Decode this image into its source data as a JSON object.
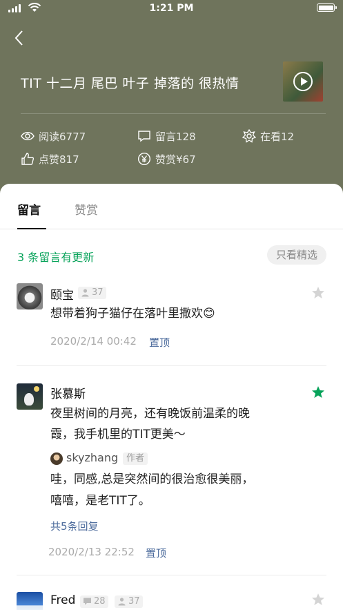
{
  "status_bar": {
    "time": "1:21 PM"
  },
  "article": {
    "title": "TIT 十二月 尾巴 叶子 掉落的 很热情",
    "stats": {
      "reads": "阅读6777",
      "comments": "留言128",
      "watching": "在看12",
      "likes": "点赞817",
      "tips": "赞赏¥67"
    }
  },
  "tabs": {
    "comments": "留言",
    "tips": "赞赏"
  },
  "updates_text": "3 条留言有更新",
  "filter_label": "只看精选",
  "comments": [
    {
      "name": "颐宝",
      "badge_count": "37",
      "text": "想带着狗子猫仔在落叶里撒欢",
      "emoji": "😊",
      "date": "2020/2/14  00:42",
      "pin": "置顶",
      "starred": false
    },
    {
      "name": "张慕斯",
      "text_line1": "夜里树间的月亮，还有晚饭前温柔的晚",
      "text_line2": "霞，我手机里的TIT更美～",
      "reply": {
        "name": "skyzhang",
        "tag": "作者",
        "line1": "哇，同感,总是突然间的很治愈很美丽，",
        "line2": "嘻嘻，是老TIT了。"
      },
      "replies_link": "共5条回复",
      "date": "2020/2/13  22:52",
      "pin": "置顶",
      "starred": true
    },
    {
      "name": "Fred",
      "comment_count": "28",
      "badge_count": "37",
      "starred": false
    }
  ],
  "colors": {
    "accent_green": "#07a35a",
    "header_bg": "#6f745c",
    "link_blue": "#4c6b9c"
  }
}
